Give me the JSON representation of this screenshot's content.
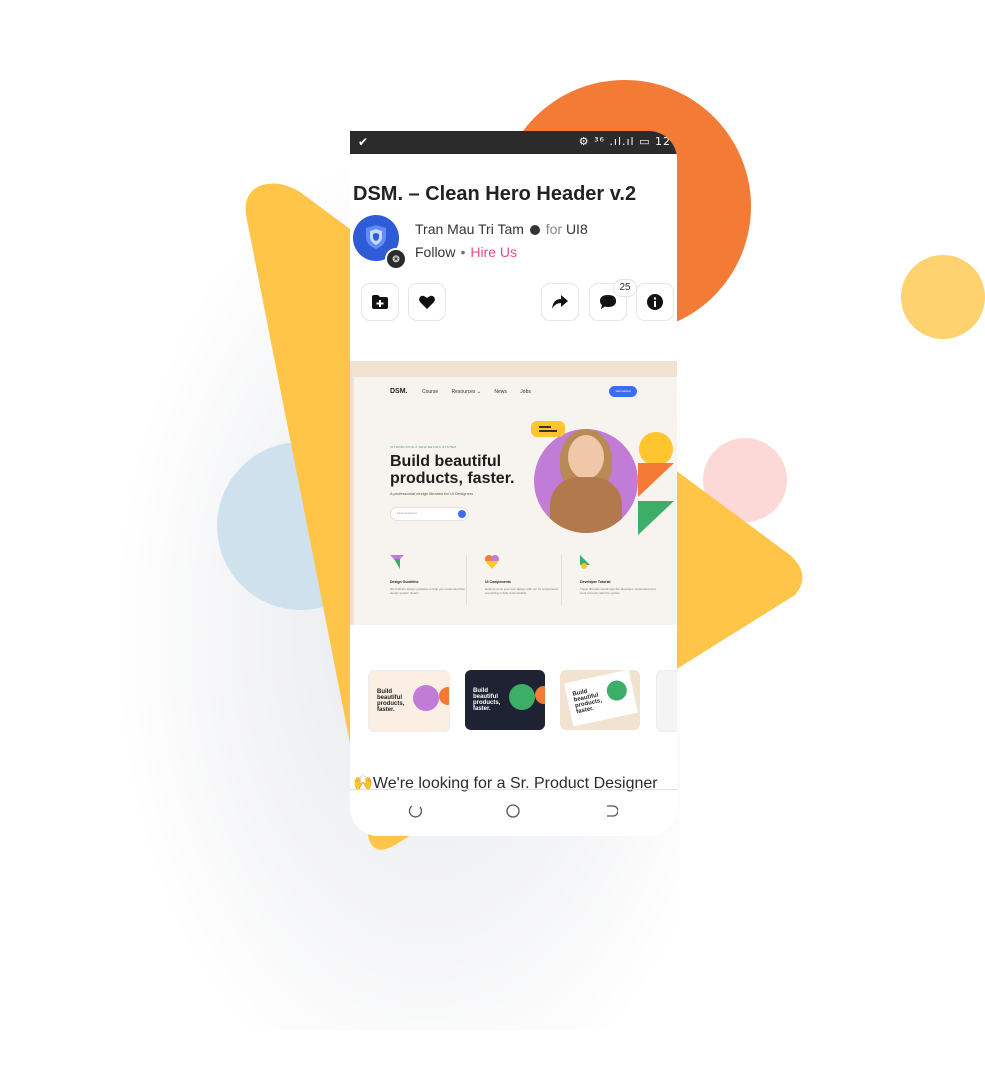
{
  "colors": {
    "accent_orange": "#f47b36",
    "accent_yellow": "#fec52e",
    "hire_pink": "#ea4c89",
    "avatar_blue": "#2f5bd6",
    "status_bar": "#2b2b2b"
  },
  "status_bar": {
    "signal_text": "⚙ ³⁶ .ıl.ıl ▭ 12"
  },
  "shot": {
    "title": "DSM. – Clean Hero Header v.2",
    "author": "Tran Mau Tri Tam",
    "for_label": "for",
    "team": "UI8",
    "follow_label": "Follow",
    "separator": "•",
    "hire_label": "Hire Us",
    "comment_count": "25",
    "actions": {
      "collection_icon": "folder-plus-icon",
      "like_icon": "heart-icon",
      "share_icon": "share-arrow-icon",
      "comment_icon": "chat-bubble-icon",
      "info_icon": "info-icon"
    }
  },
  "preview": {
    "logo": "DSM.",
    "nav": [
      "Course",
      "Resources ⌄",
      "News",
      "Jobs"
    ],
    "cta": "Get started",
    "kicker": "INTRODUCING A NEW DESIGN SYSTEM",
    "headline": "Build beautiful products, faster.",
    "subline": "A professional design libraries for UI Designers",
    "search_placeholder": "Find resources",
    "columns": [
      {
        "title": "Design Guideline",
        "desc": "We built the design guideline to help you understand the design system clearly"
      },
      {
        "title": "UI Components",
        "desc": "Grab and mix your own design with our UI components, everything is fully customizable"
      },
      {
        "title": "Developer Tutorial",
        "desc": "These libraries would help the developer understand and work correctly with the system"
      }
    ]
  },
  "thumbnails": [
    {
      "headline": "Build beautiful products, faster.",
      "theme": "light"
    },
    {
      "headline": "Build beautiful products, faster.",
      "theme": "dark"
    },
    {
      "headline": "Build beautiful products, faster.",
      "theme": "tilted"
    }
  ],
  "job_banner": "🙌We're looking for a Sr. Product Designer",
  "system_nav": {
    "back_icon": "back-icon",
    "home_icon": "home-icon",
    "recents_icon": "recents-icon"
  }
}
